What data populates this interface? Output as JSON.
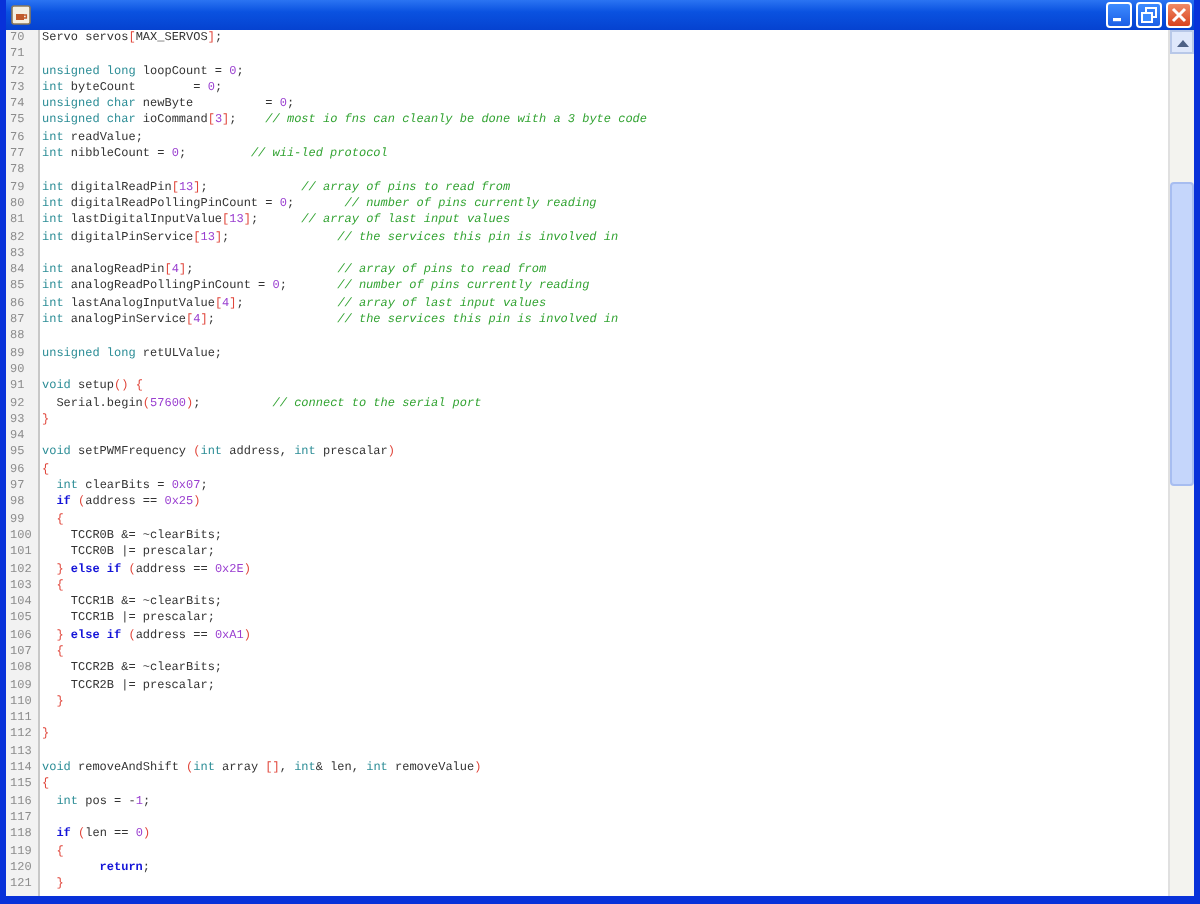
{
  "editor": {
    "lines": [
      {
        "number": "70",
        "tokens": [
          {
            "kind": "tx",
            "text": "Servo servos"
          },
          {
            "kind": "br",
            "text": "["
          },
          {
            "kind": "tx",
            "text": "MAX_SERVOS"
          },
          {
            "kind": "br",
            "text": "]"
          },
          {
            "kind": "tx",
            "text": ";"
          }
        ]
      },
      {
        "number": "71"
      },
      {
        "number": "72",
        "tokens": [
          {
            "kind": "kw",
            "text": "unsigned long"
          },
          {
            "kind": "tx",
            "text": " loopCount = "
          },
          {
            "kind": "nu",
            "text": "0"
          },
          {
            "kind": "tx",
            "text": ";"
          }
        ]
      },
      {
        "number": "73",
        "tokens": [
          {
            "kind": "kw",
            "text": "int"
          },
          {
            "kind": "tx",
            "text": " byteCount        = "
          },
          {
            "kind": "nu",
            "text": "0"
          },
          {
            "kind": "tx",
            "text": ";"
          }
        ]
      },
      {
        "number": "74",
        "tokens": [
          {
            "kind": "kw",
            "text": "unsigned char"
          },
          {
            "kind": "tx",
            "text": " newByte          = "
          },
          {
            "kind": "nu",
            "text": "0"
          },
          {
            "kind": "tx",
            "text": ";"
          }
        ]
      },
      {
        "number": "75",
        "tokens": [
          {
            "kind": "kw",
            "text": "unsigned char"
          },
          {
            "kind": "tx",
            "text": " ioCommand"
          },
          {
            "kind": "br",
            "text": "["
          },
          {
            "kind": "nu",
            "text": "3"
          },
          {
            "kind": "br",
            "text": "]"
          },
          {
            "kind": "tx",
            "text": ";    "
          },
          {
            "kind": "cm",
            "text": "// most io fns can cleanly be done with a 3 byte code"
          }
        ]
      },
      {
        "number": "76",
        "tokens": [
          {
            "kind": "kw",
            "text": "int"
          },
          {
            "kind": "tx",
            "text": " readValue;"
          }
        ]
      },
      {
        "number": "77",
        "tokens": [
          {
            "kind": "kw",
            "text": "int"
          },
          {
            "kind": "tx",
            "text": " nibbleCount = "
          },
          {
            "kind": "nu",
            "text": "0"
          },
          {
            "kind": "tx",
            "text": ";         "
          },
          {
            "kind": "cm",
            "text": "// wii-led protocol"
          }
        ]
      },
      {
        "number": "78"
      },
      {
        "number": "79",
        "tokens": [
          {
            "kind": "kw",
            "text": "int"
          },
          {
            "kind": "tx",
            "text": " digitalReadPin"
          },
          {
            "kind": "br",
            "text": "["
          },
          {
            "kind": "nu",
            "text": "13"
          },
          {
            "kind": "br",
            "text": "]"
          },
          {
            "kind": "tx",
            "text": ";             "
          },
          {
            "kind": "cm",
            "text": "// array of pins to read from"
          }
        ]
      },
      {
        "number": "80",
        "tokens": [
          {
            "kind": "kw",
            "text": "int"
          },
          {
            "kind": "tx",
            "text": " digitalReadPollingPinCount = "
          },
          {
            "kind": "nu",
            "text": "0"
          },
          {
            "kind": "tx",
            "text": ";       "
          },
          {
            "kind": "cm",
            "text": "// number of pins currently reading"
          }
        ]
      },
      {
        "number": "81",
        "tokens": [
          {
            "kind": "kw",
            "text": "int"
          },
          {
            "kind": "tx",
            "text": " lastDigitalInputValue"
          },
          {
            "kind": "br",
            "text": "["
          },
          {
            "kind": "nu",
            "text": "13"
          },
          {
            "kind": "br",
            "text": "]"
          },
          {
            "kind": "tx",
            "text": ";      "
          },
          {
            "kind": "cm",
            "text": "// array of last input values"
          }
        ]
      },
      {
        "number": "82",
        "tokens": [
          {
            "kind": "kw",
            "text": "int"
          },
          {
            "kind": "tx",
            "text": " digitalPinService"
          },
          {
            "kind": "br",
            "text": "["
          },
          {
            "kind": "nu",
            "text": "13"
          },
          {
            "kind": "br",
            "text": "]"
          },
          {
            "kind": "tx",
            "text": ";               "
          },
          {
            "kind": "cm",
            "text": "// the services this pin is involved in"
          }
        ]
      },
      {
        "number": "83"
      },
      {
        "number": "84",
        "tokens": [
          {
            "kind": "kw",
            "text": "int"
          },
          {
            "kind": "tx",
            "text": " analogReadPin"
          },
          {
            "kind": "br",
            "text": "["
          },
          {
            "kind": "nu",
            "text": "4"
          },
          {
            "kind": "br",
            "text": "]"
          },
          {
            "kind": "tx",
            "text": ";                    "
          },
          {
            "kind": "cm",
            "text": "// array of pins to read from"
          }
        ]
      },
      {
        "number": "85",
        "tokens": [
          {
            "kind": "kw",
            "text": "int"
          },
          {
            "kind": "tx",
            "text": " analogReadPollingPinCount = "
          },
          {
            "kind": "nu",
            "text": "0"
          },
          {
            "kind": "tx",
            "text": ";       "
          },
          {
            "kind": "cm",
            "text": "// number of pins currently reading"
          }
        ]
      },
      {
        "number": "86",
        "tokens": [
          {
            "kind": "kw",
            "text": "int"
          },
          {
            "kind": "tx",
            "text": " lastAnalogInputValue"
          },
          {
            "kind": "br",
            "text": "["
          },
          {
            "kind": "nu",
            "text": "4"
          },
          {
            "kind": "br",
            "text": "]"
          },
          {
            "kind": "tx",
            "text": ";             "
          },
          {
            "kind": "cm",
            "text": "// array of last input values"
          }
        ]
      },
      {
        "number": "87",
        "tokens": [
          {
            "kind": "kw",
            "text": "int"
          },
          {
            "kind": "tx",
            "text": " analogPinService"
          },
          {
            "kind": "br",
            "text": "["
          },
          {
            "kind": "nu",
            "text": "4"
          },
          {
            "kind": "br",
            "text": "]"
          },
          {
            "kind": "tx",
            "text": ";                 "
          },
          {
            "kind": "cm",
            "text": "// the services this pin is involved in"
          }
        ]
      },
      {
        "number": "88"
      },
      {
        "number": "89",
        "tokens": [
          {
            "kind": "kw",
            "text": "unsigned long"
          },
          {
            "kind": "tx",
            "text": " retULValue;"
          }
        ]
      },
      {
        "number": "90"
      },
      {
        "number": "91",
        "tokens": [
          {
            "kind": "kw",
            "text": "void"
          },
          {
            "kind": "tx",
            "text": " setup"
          },
          {
            "kind": "br",
            "text": "() {"
          }
        ]
      },
      {
        "number": "92",
        "tokens": [
          {
            "kind": "tx",
            "text": "  Serial.begin"
          },
          {
            "kind": "br",
            "text": "("
          },
          {
            "kind": "nu",
            "text": "57600"
          },
          {
            "kind": "br",
            "text": ")"
          },
          {
            "kind": "tx",
            "text": ";          "
          },
          {
            "kind": "cm",
            "text": "// connect to the serial port"
          }
        ]
      },
      {
        "number": "93",
        "tokens": [
          {
            "kind": "br",
            "text": "}"
          }
        ]
      },
      {
        "number": "94"
      },
      {
        "number": "95",
        "tokens": [
          {
            "kind": "kw",
            "text": "void"
          },
          {
            "kind": "tx",
            "text": " setPWMFrequency "
          },
          {
            "kind": "br",
            "text": "("
          },
          {
            "kind": "kw",
            "text": "int"
          },
          {
            "kind": "tx",
            "text": " address, "
          },
          {
            "kind": "kw",
            "text": "int"
          },
          {
            "kind": "tx",
            "text": " prescalar"
          },
          {
            "kind": "br",
            "text": ")"
          }
        ]
      },
      {
        "number": "96",
        "tokens": [
          {
            "kind": "br",
            "text": "{"
          }
        ]
      },
      {
        "number": "97",
        "tokens": [
          {
            "kind": "kw",
            "text": "  int"
          },
          {
            "kind": "tx",
            "text": " clearBits = "
          },
          {
            "kind": "nu",
            "text": "0x07"
          },
          {
            "kind": "tx",
            "text": ";"
          }
        ]
      },
      {
        "number": "98",
        "tokens": [
          {
            "kind": "ct",
            "text": "  if "
          },
          {
            "kind": "br",
            "text": "("
          },
          {
            "kind": "tx",
            "text": "address == "
          },
          {
            "kind": "nu",
            "text": "0x25"
          },
          {
            "kind": "br",
            "text": ")"
          }
        ]
      },
      {
        "number": "99",
        "tokens": [
          {
            "kind": "br",
            "text": "  {"
          }
        ]
      },
      {
        "number": "100",
        "tokens": [
          {
            "kind": "tx",
            "text": "    TCCR0B &= ~clearBits;"
          }
        ]
      },
      {
        "number": "101",
        "tokens": [
          {
            "kind": "tx",
            "text": "    TCCR0B |= prescalar;"
          }
        ]
      },
      {
        "number": "102",
        "tokens": [
          {
            "kind": "br",
            "text": "  }"
          },
          {
            "kind": "ct",
            "text": " else if "
          },
          {
            "kind": "br",
            "text": "("
          },
          {
            "kind": "tx",
            "text": "address == "
          },
          {
            "kind": "nu",
            "text": "0x2E"
          },
          {
            "kind": "br",
            "text": ")"
          }
        ]
      },
      {
        "number": "103",
        "tokens": [
          {
            "kind": "br",
            "text": "  {"
          }
        ]
      },
      {
        "number": "104",
        "tokens": [
          {
            "kind": "tx",
            "text": "    TCCR1B &= ~clearBits;"
          }
        ]
      },
      {
        "number": "105",
        "tokens": [
          {
            "kind": "tx",
            "text": "    TCCR1B |= prescalar;"
          }
        ]
      },
      {
        "number": "106",
        "tokens": [
          {
            "kind": "br",
            "text": "  }"
          },
          {
            "kind": "ct",
            "text": " else if "
          },
          {
            "kind": "br",
            "text": "("
          },
          {
            "kind": "tx",
            "text": "address == "
          },
          {
            "kind": "nu",
            "text": "0xA1"
          },
          {
            "kind": "br",
            "text": ")"
          }
        ]
      },
      {
        "number": "107",
        "tokens": [
          {
            "kind": "br",
            "text": "  {"
          }
        ]
      },
      {
        "number": "108",
        "tokens": [
          {
            "kind": "tx",
            "text": "    TCCR2B &= ~clearBits;"
          }
        ]
      },
      {
        "number": "109",
        "tokens": [
          {
            "kind": "tx",
            "text": "    TCCR2B |= prescalar;"
          }
        ]
      },
      {
        "number": "110",
        "tokens": [
          {
            "kind": "br",
            "text": "  }"
          }
        ]
      },
      {
        "number": "111"
      },
      {
        "number": "112",
        "tokens": [
          {
            "kind": "br",
            "text": "}"
          }
        ]
      },
      {
        "number": "113"
      },
      {
        "number": "114",
        "tokens": [
          {
            "kind": "kw",
            "text": "void"
          },
          {
            "kind": "tx",
            "text": " removeAndShift "
          },
          {
            "kind": "br",
            "text": "("
          },
          {
            "kind": "kw",
            "text": "int"
          },
          {
            "kind": "tx",
            "text": " array "
          },
          {
            "kind": "br",
            "text": "[]"
          },
          {
            "kind": "tx",
            "text": ", "
          },
          {
            "kind": "kw",
            "text": "int"
          },
          {
            "kind": "tx",
            "text": "& len, "
          },
          {
            "kind": "kw",
            "text": "int"
          },
          {
            "kind": "tx",
            "text": " removeValue"
          },
          {
            "kind": "br",
            "text": ")"
          }
        ]
      },
      {
        "number": "115",
        "tokens": [
          {
            "kind": "br",
            "text": "{"
          }
        ]
      },
      {
        "number": "116",
        "tokens": [
          {
            "kind": "kw",
            "text": "  int"
          },
          {
            "kind": "tx",
            "text": " pos = -"
          },
          {
            "kind": "nu",
            "text": "1"
          },
          {
            "kind": "tx",
            "text": ";"
          }
        ]
      },
      {
        "number": "117"
      },
      {
        "number": "118",
        "tokens": [
          {
            "kind": "ct",
            "text": "  if "
          },
          {
            "kind": "br",
            "text": "("
          },
          {
            "kind": "tx",
            "text": "len == "
          },
          {
            "kind": "nu",
            "text": "0"
          },
          {
            "kind": "br",
            "text": ")"
          }
        ]
      },
      {
        "number": "119",
        "tokens": [
          {
            "kind": "br",
            "text": "  {"
          }
        ]
      },
      {
        "number": "120",
        "tokens": [
          {
            "kind": "ct",
            "text": "        return"
          },
          {
            "kind": "tx",
            "text": ";"
          }
        ]
      },
      {
        "number": "121",
        "tokens": [
          {
            "kind": "br",
            "text": "  }"
          }
        ]
      }
    ]
  }
}
